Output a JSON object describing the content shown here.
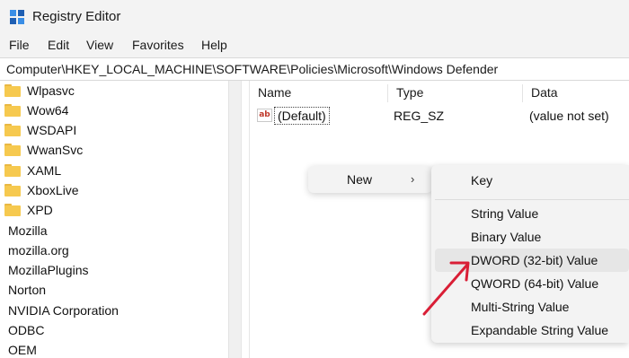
{
  "window": {
    "title": "Registry Editor",
    "icon": "registry-icon"
  },
  "menubar": {
    "items": [
      "File",
      "Edit",
      "View",
      "Favorites",
      "Help"
    ]
  },
  "address": {
    "path": "Computer\\HKEY_LOCAL_MACHINE\\SOFTWARE\\Policies\\Microsoft\\Windows Defender"
  },
  "tree": {
    "folders": [
      "Wlpasvc",
      "Wow64",
      "WSDAPI",
      "WwanSvc",
      "XAML",
      "XboxLive",
      "XPD"
    ],
    "keys": [
      "Mozilla",
      "mozilla.org",
      "MozillaPlugins",
      "Norton",
      "NVIDIA Corporation",
      "ODBC",
      "OEM"
    ]
  },
  "list": {
    "columns": {
      "name": "Name",
      "type": "Type",
      "data": "Data"
    },
    "rows": [
      {
        "name": "(Default)",
        "type": "REG_SZ",
        "data": "(value not set)",
        "icon": "string-value-icon"
      }
    ]
  },
  "context_menu": {
    "new_label": "New",
    "arrow": "›"
  },
  "submenu": {
    "key": "Key",
    "items": [
      "String Value",
      "Binary Value",
      "DWORD (32-bit) Value",
      "QWORD (64-bit) Value",
      "Multi-String Value",
      "Expandable String Value"
    ],
    "highlighted": "DWORD (32-bit) Value"
  },
  "colors": {
    "folder": "#f6c94f",
    "annotation_arrow": "#d91e36",
    "menu_bg": "#f3f3f3"
  }
}
